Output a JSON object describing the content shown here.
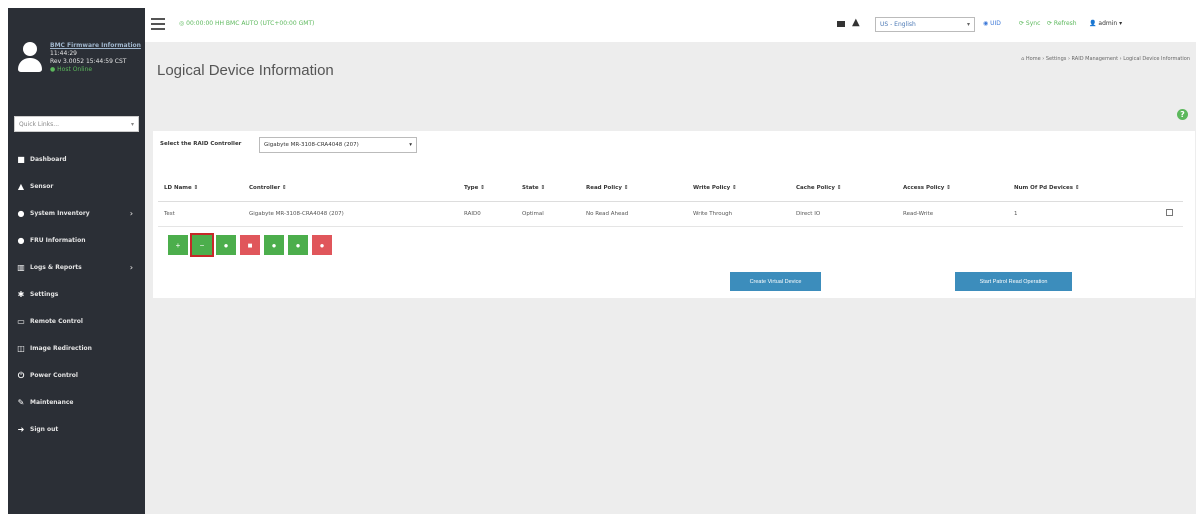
{
  "sidebar": {
    "user_lines": [
      "BMC Firmware Information",
      "11:44:29",
      "Rev 3.0052 15:44:59 CST",
      "● Host Online"
    ],
    "quick_links_placeholder": "Quick Links...",
    "items": [
      {
        "label": "Dashboard",
        "icon": "dashboard-icon",
        "glyph": "■",
        "arrow": ""
      },
      {
        "label": "Sensor",
        "icon": "sensor-icon",
        "glyph": "▲",
        "arrow": ""
      },
      {
        "label": "System Inventory",
        "icon": "info-icon",
        "glyph": "●",
        "arrow": "›"
      },
      {
        "label": "FRU Information",
        "icon": "info-circle-icon",
        "glyph": "●",
        "arrow": ""
      },
      {
        "label": "Logs & Reports",
        "icon": "chart-icon",
        "glyph": "▥",
        "arrow": "›"
      },
      {
        "label": "Settings",
        "icon": "gear-icon",
        "glyph": "✱",
        "arrow": ""
      },
      {
        "label": "Remote Control",
        "icon": "monitor-icon",
        "glyph": "▭",
        "arrow": ""
      },
      {
        "label": "Image Redirection",
        "icon": "image-icon",
        "glyph": "◫",
        "arrow": ""
      },
      {
        "label": "Power Control",
        "icon": "power-icon",
        "glyph": "⏻",
        "arrow": ""
      },
      {
        "label": "Maintenance",
        "icon": "wrench-icon",
        "glyph": "✎",
        "arrow": ""
      },
      {
        "label": "Sign out",
        "icon": "sign-out-icon",
        "glyph": "➜",
        "arrow": ""
      }
    ]
  },
  "topbar": {
    "status": "◎ 00:00:00 HH BMC AUTO (UTC+00:00 GMT)",
    "language": "US - English",
    "uid_label": "◉ UID",
    "sync_label": "⟳ Sync",
    "refresh_label": "⟳ Refresh",
    "admin_label": "admin ▾"
  },
  "page": {
    "title": "Logical Device Information",
    "breadcrumb": "⌂ Home › Settings › RAID Management › Logical Device Information"
  },
  "controller": {
    "label": "Select the RAID Controller",
    "selected": "Gigabyte MR-3108-CRA4048 (207)"
  },
  "table": {
    "headers": [
      "LD Name ⇕",
      "Controller ⇕",
      "Type ⇕",
      "State ⇕",
      "Read Policy ⇕",
      "Write Policy ⇕",
      "Cache Policy ⇕",
      "Access Policy ⇕",
      "Num Of Pd Devices ⇕",
      ""
    ],
    "rows": [
      [
        "Test",
        "Gigabyte MR-3108-CRA4048 (207)",
        "RAID0",
        "Optimal",
        "No Read Ahead",
        "Write Through",
        "Direct IO",
        "Read-Write",
        "1",
        ""
      ]
    ]
  },
  "actions": [
    {
      "name": "expand-button",
      "glyph": "+",
      "color": "green"
    },
    {
      "name": "collapse-button",
      "glyph": "−",
      "color": "green",
      "selected": true
    },
    {
      "name": "action-button-3",
      "glyph": "●",
      "color": "green"
    },
    {
      "name": "delete-button",
      "glyph": "■",
      "color": "red"
    },
    {
      "name": "action-button-5",
      "glyph": "●",
      "color": "green"
    },
    {
      "name": "action-button-6",
      "glyph": "●",
      "color": "green"
    },
    {
      "name": "action-button-7",
      "glyph": "●",
      "color": "red"
    }
  ],
  "buttons": {
    "create": "Create Virtual Device",
    "start": "Start Patrol Read Operation"
  },
  "colors": {
    "sidebar_bg": "#2b2f36",
    "green": "#4cae4c",
    "red": "#e0565b",
    "blue": "#3c8dbc"
  }
}
